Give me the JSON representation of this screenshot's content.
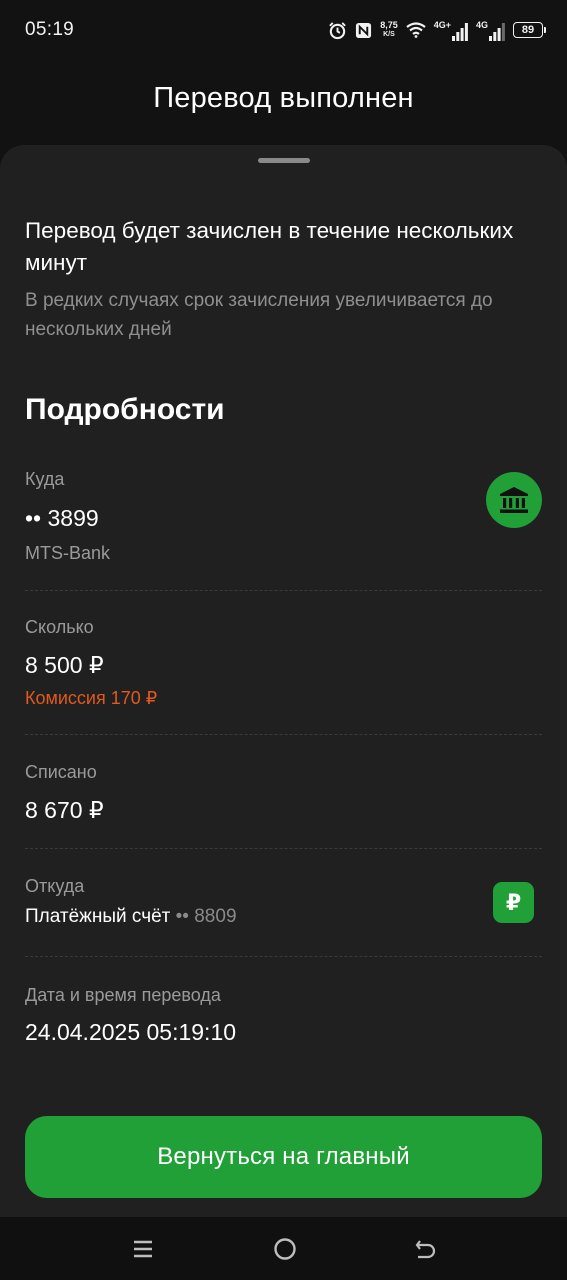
{
  "status_bar": {
    "time": "05:19",
    "speed_value": "8,75",
    "speed_unit": "K/S",
    "net1": "4G+",
    "net2": "4G",
    "battery": "89",
    "icons": [
      "alarm-icon",
      "nfc-icon",
      "wifi-icon",
      "signal-icon",
      "signal-icon",
      "battery-icon"
    ]
  },
  "header": {
    "title": "Перевод выполнен"
  },
  "notice": {
    "title": "Перевод будет зачислен в течение нескольких минут",
    "text": "В редких случаях срок зачисления увеличивается до нескольких дней"
  },
  "details": {
    "heading": "Подробности",
    "to": {
      "label": "Куда",
      "value": "•• 3899",
      "bank": "MTS-Bank",
      "icon": "bank-icon"
    },
    "amount": {
      "label": "Сколько",
      "value": "8 500 ₽",
      "fee": "Комиссия 170 ₽"
    },
    "debited": {
      "label": "Списано",
      "value": "8 670 ₽"
    },
    "from": {
      "label": "Откуда",
      "account": "Платёжный счёт",
      "mask": "•• 8809",
      "icon": "ruble-icon",
      "icon_glyph": "₽"
    },
    "datetime": {
      "label": "Дата и время перевода",
      "value": "24.04.2025 05:19:10"
    }
  },
  "actions": {
    "home_label": "Вернуться на главный"
  },
  "nav": {
    "items": [
      "menu-icon",
      "home-icon",
      "back-icon"
    ]
  },
  "colors": {
    "accent": "#21a038",
    "fee": "#e0591e",
    "sheet": "#202020",
    "background": "#121212"
  }
}
